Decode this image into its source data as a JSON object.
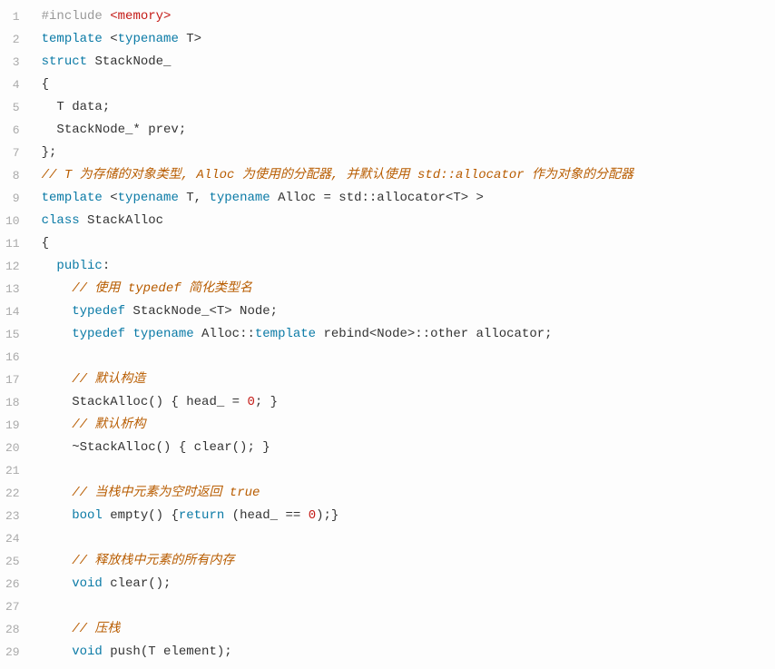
{
  "code": {
    "lines": [
      {
        "num": "1",
        "tokens": [
          {
            "cls": "tok-preproc",
            "t": "#include"
          },
          {
            "cls": "",
            "t": " "
          },
          {
            "cls": "tok-angle",
            "t": "<memory>"
          }
        ]
      },
      {
        "num": "2",
        "tokens": [
          {
            "cls": "tok-keyword",
            "t": "template"
          },
          {
            "cls": "",
            "t": " <"
          },
          {
            "cls": "tok-keyword",
            "t": "typename"
          },
          {
            "cls": "",
            "t": " T>"
          }
        ]
      },
      {
        "num": "3",
        "tokens": [
          {
            "cls": "tok-keyword",
            "t": "struct"
          },
          {
            "cls": "",
            "t": " "
          },
          {
            "cls": "tok-ident",
            "t": "StackNode_"
          }
        ]
      },
      {
        "num": "4",
        "tokens": [
          {
            "cls": "",
            "t": "{"
          }
        ]
      },
      {
        "num": "5",
        "tokens": [
          {
            "cls": "",
            "t": "  T data;"
          }
        ]
      },
      {
        "num": "6",
        "tokens": [
          {
            "cls": "",
            "t": "  StackNode_* prev;"
          }
        ]
      },
      {
        "num": "7",
        "tokens": [
          {
            "cls": "",
            "t": "};"
          }
        ]
      },
      {
        "num": "8",
        "tokens": [
          {
            "cls": "tok-comment",
            "t": "// T 为存储的对象类型, Alloc 为使用的分配器, 并默认使用 std::allocator 作为对象的分配器"
          }
        ]
      },
      {
        "num": "9",
        "tokens": [
          {
            "cls": "tok-keyword",
            "t": "template"
          },
          {
            "cls": "",
            "t": " <"
          },
          {
            "cls": "tok-keyword",
            "t": "typename"
          },
          {
            "cls": "",
            "t": " T, "
          },
          {
            "cls": "tok-keyword",
            "t": "typename"
          },
          {
            "cls": "",
            "t": " Alloc = std::allocator<T> >"
          }
        ]
      },
      {
        "num": "10",
        "tokens": [
          {
            "cls": "tok-keyword",
            "t": "class"
          },
          {
            "cls": "",
            "t": " "
          },
          {
            "cls": "tok-ident",
            "t": "StackAlloc"
          }
        ]
      },
      {
        "num": "11",
        "tokens": [
          {
            "cls": "",
            "t": "{"
          }
        ]
      },
      {
        "num": "12",
        "tokens": [
          {
            "cls": "",
            "t": "  "
          },
          {
            "cls": "tok-keyword",
            "t": "public"
          },
          {
            "cls": "",
            "t": ":"
          }
        ]
      },
      {
        "num": "13",
        "tokens": [
          {
            "cls": "",
            "t": "    "
          },
          {
            "cls": "tok-comment",
            "t": "// 使用 typedef 简化类型名"
          }
        ]
      },
      {
        "num": "14",
        "tokens": [
          {
            "cls": "",
            "t": "    "
          },
          {
            "cls": "tok-keyword",
            "t": "typedef"
          },
          {
            "cls": "",
            "t": " StackNode_<T> Node;"
          }
        ]
      },
      {
        "num": "15",
        "tokens": [
          {
            "cls": "",
            "t": "    "
          },
          {
            "cls": "tok-keyword",
            "t": "typedef"
          },
          {
            "cls": "",
            "t": " "
          },
          {
            "cls": "tok-keyword",
            "t": "typename"
          },
          {
            "cls": "",
            "t": " Alloc::"
          },
          {
            "cls": "tok-keyword",
            "t": "template"
          },
          {
            "cls": "",
            "t": " rebind<Node>::other allocator;"
          }
        ]
      },
      {
        "num": "16",
        "tokens": [
          {
            "cls": "",
            "t": ""
          }
        ]
      },
      {
        "num": "17",
        "tokens": [
          {
            "cls": "",
            "t": "    "
          },
          {
            "cls": "tok-comment",
            "t": "// 默认构造"
          }
        ]
      },
      {
        "num": "18",
        "tokens": [
          {
            "cls": "",
            "t": "    StackAlloc() { head_ = "
          },
          {
            "cls": "tok-number",
            "t": "0"
          },
          {
            "cls": "",
            "t": "; }"
          }
        ]
      },
      {
        "num": "19",
        "tokens": [
          {
            "cls": "",
            "t": "    "
          },
          {
            "cls": "tok-comment",
            "t": "// 默认析构"
          }
        ]
      },
      {
        "num": "20",
        "tokens": [
          {
            "cls": "",
            "t": "    ~StackAlloc() { clear(); }"
          }
        ]
      },
      {
        "num": "21",
        "tokens": [
          {
            "cls": "",
            "t": ""
          }
        ]
      },
      {
        "num": "22",
        "tokens": [
          {
            "cls": "",
            "t": "    "
          },
          {
            "cls": "tok-comment",
            "t": "// 当栈中元素为空时返回 true"
          }
        ]
      },
      {
        "num": "23",
        "tokens": [
          {
            "cls": "",
            "t": "    "
          },
          {
            "cls": "tok-keyword",
            "t": "bool"
          },
          {
            "cls": "",
            "t": " empty() {"
          },
          {
            "cls": "tok-keyword",
            "t": "return"
          },
          {
            "cls": "",
            "t": " (head_ == "
          },
          {
            "cls": "tok-number",
            "t": "0"
          },
          {
            "cls": "",
            "t": ");}"
          }
        ]
      },
      {
        "num": "24",
        "tokens": [
          {
            "cls": "",
            "t": ""
          }
        ]
      },
      {
        "num": "25",
        "tokens": [
          {
            "cls": "",
            "t": "    "
          },
          {
            "cls": "tok-comment",
            "t": "// 释放栈中元素的所有内存"
          }
        ]
      },
      {
        "num": "26",
        "tokens": [
          {
            "cls": "",
            "t": "    "
          },
          {
            "cls": "tok-keyword",
            "t": "void"
          },
          {
            "cls": "",
            "t": " clear();"
          }
        ]
      },
      {
        "num": "27",
        "tokens": [
          {
            "cls": "",
            "t": ""
          }
        ]
      },
      {
        "num": "28",
        "tokens": [
          {
            "cls": "",
            "t": "    "
          },
          {
            "cls": "tok-comment",
            "t": "// 压栈"
          }
        ]
      },
      {
        "num": "29",
        "tokens": [
          {
            "cls": "",
            "t": "    "
          },
          {
            "cls": "tok-keyword",
            "t": "void"
          },
          {
            "cls": "",
            "t": " push(T element);"
          }
        ]
      }
    ]
  }
}
